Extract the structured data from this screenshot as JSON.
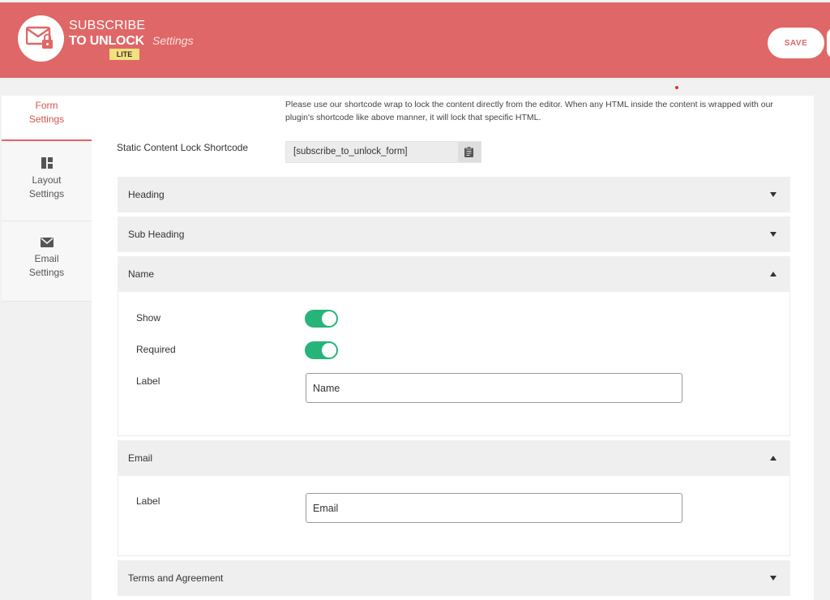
{
  "header": {
    "brand_line1": "SUBSCRIBE",
    "brand_line2": "TO UNLOCK",
    "badge": "LITE",
    "subtitle": "Settings",
    "save_label": "SAVE",
    "bg_color": "#e06767"
  },
  "sidebar": {
    "items": [
      {
        "label": "Form Settings",
        "icon": "form-icon",
        "active": true
      },
      {
        "label": "Layout Settings",
        "icon": "layout-icon",
        "active": false
      },
      {
        "label": "Email Settings",
        "icon": "envelope-icon",
        "active": false
      }
    ]
  },
  "main": {
    "notice": "Please use our shortcode wrap to lock the content directly from the editor. When any HTML inside the content is wrapped with our plugin's shortcode like above manner, it will lock that specific HTML.",
    "shortcode_label": "Static Content Lock Shortcode",
    "shortcode_value": "[subscribe_to_unlock_form]",
    "sections": [
      {
        "title": "Heading",
        "expanded": false
      },
      {
        "title": "Sub Heading",
        "expanded": false
      },
      {
        "title": "Name",
        "expanded": true
      },
      {
        "title": "Email",
        "expanded": true
      },
      {
        "title": "Terms and Agreement",
        "expanded": false
      }
    ],
    "name_panel": {
      "show_label": "Show",
      "show_on": true,
      "required_label": "Required",
      "required_on": true,
      "label_label": "Label",
      "label_value": "Name"
    },
    "email_panel": {
      "label_label": "Label",
      "label_value": "Email"
    },
    "toggle_color": "#27b47a"
  }
}
